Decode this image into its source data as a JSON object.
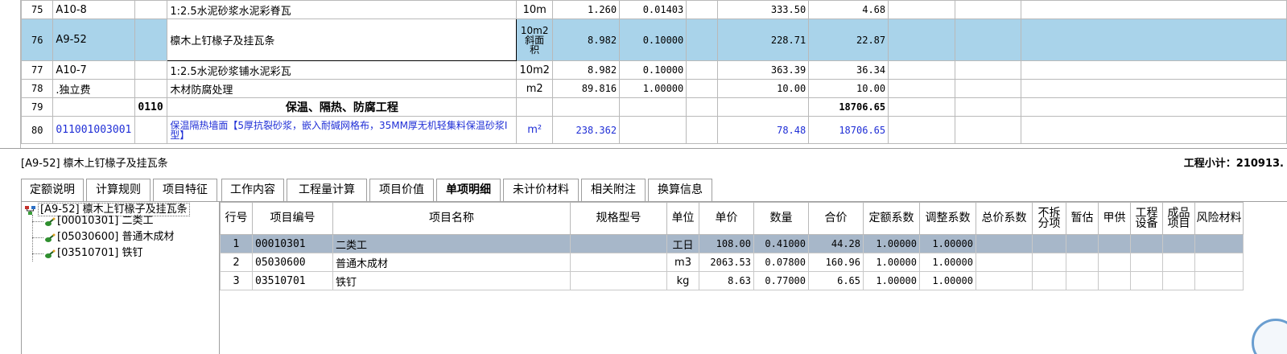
{
  "upper_rows": [
    {
      "rn": "75",
      "code": "A10-8",
      "sect": "",
      "name": "1:2.5水泥砂浆水泥彩脊瓦",
      "unit": "10m",
      "qty": "1.260",
      "coef": "0.01403",
      "x": "",
      "price": "333.50",
      "total": "4.68"
    },
    {
      "rn": "76",
      "code": "A9-52",
      "sect": "",
      "name": "檩木上钉椽子及挂瓦条",
      "unit": "10m2 斜面 积",
      "qty": "8.982",
      "coef": "0.10000",
      "x": "",
      "price": "228.71",
      "total": "22.87"
    },
    {
      "rn": "77",
      "code": "A10-7",
      "sect": "",
      "name": "1:2.5水泥砂浆铺水泥彩瓦",
      "unit": "10m2",
      "qty": "8.982",
      "coef": "0.10000",
      "x": "",
      "price": "363.39",
      "total": "36.34"
    },
    {
      "rn": "78",
      "code": ".独立费",
      "sect": "",
      "name": "木材防腐处理",
      "unit": "m2",
      "qty": "89.816",
      "coef": "1.00000",
      "x": "",
      "price": "10.00",
      "total": "10.00"
    },
    {
      "rn": "79",
      "code": "",
      "sect": "0110",
      "name": "保温、隔热、防腐工程",
      "unit": "",
      "qty": "",
      "coef": "",
      "x": "",
      "price": "",
      "total": "18706.65"
    },
    {
      "rn": "80",
      "code": "011001003001",
      "sect": "",
      "name": "保温隔热墙面【5厚抗裂砂浆，嵌入耐碱网格布，35MM厚无机轻集料保温砂浆Ⅰ型】",
      "unit": "m²",
      "qty": "238.362",
      "coef": "",
      "x": "",
      "price": "78.48",
      "total": "18706.65"
    }
  ],
  "status": {
    "current": "[A9-52] 檩木上钉椽子及挂瓦条",
    "subtotal": "工程小计：210913."
  },
  "tabs": [
    "定额说明",
    "计算规则",
    "项目特征",
    "工作内容",
    "工程量计算",
    "项目价值",
    "单项明细",
    "未计价材料",
    "相关附注",
    "换算信息"
  ],
  "active_tab": "单项明细",
  "tree": {
    "root": "[A9-52] 檩木上钉椽子及挂瓦条",
    "children": [
      "[00010301] 二类工",
      "[05030600] 普通木成材",
      "[03510701] 铁钉"
    ]
  },
  "detail": {
    "headers": [
      "行号",
      "项目编号",
      "项目名称",
      "规格型号",
      "单位",
      "单价",
      "数量",
      "合价",
      "定额系数",
      "调整系数",
      "总价系数",
      "不拆分项",
      "暂估",
      "甲供",
      "工程设备",
      "成品项目",
      "风险材料"
    ],
    "rows": [
      {
        "rn": "1",
        "code": "00010301",
        "name": "二类工",
        "spec": "",
        "unit": "工日",
        "price": "108.00",
        "qty": "0.41000",
        "total": "44.28",
        "c1": "1.00000",
        "c2": "1.00000"
      },
      {
        "rn": "2",
        "code": "05030600",
        "name": "普通木成材",
        "spec": "",
        "unit": "m3",
        "price": "2063.53",
        "qty": "0.07800",
        "total": "160.96",
        "c1": "1.00000",
        "c2": "1.00000"
      },
      {
        "rn": "3",
        "code": "03510701",
        "name": "铁钉",
        "spec": "",
        "unit": "kg",
        "price": "8.63",
        "qty": "0.77000",
        "total": "6.65",
        "c1": "1.00000",
        "c2": "1.00000"
      }
    ]
  },
  "colors": {
    "selected_row": "#a9d3ea",
    "detail_selected": "#a7b7c9",
    "blue_text": "#1f2ed6"
  }
}
